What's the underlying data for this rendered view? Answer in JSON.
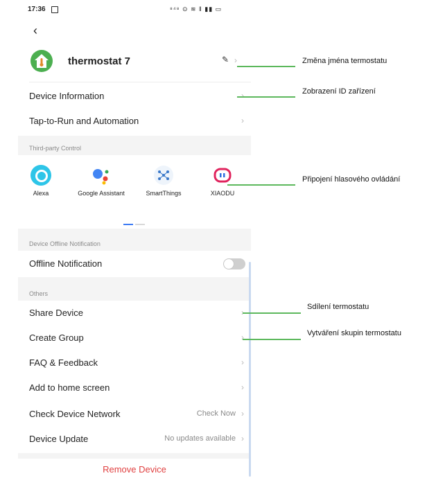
{
  "status_bar": {
    "time": "17:36",
    "icons_text": "⁸⁴⁸ ⊙ ≋ ‖ ▮▮ ▭"
  },
  "header": {
    "device_name": "thermostat 7",
    "edit_icon": "pencil-icon",
    "avatar_icon": "thermostat-house-icon"
  },
  "rows_top": [
    {
      "label": "Device Information"
    },
    {
      "label": "Tap-to-Run and Automation"
    }
  ],
  "third_party": {
    "section_title": "Third-party Control",
    "items": [
      {
        "label": "Alexa",
        "icon": "alexa-icon"
      },
      {
        "label": "Google Assistant",
        "icon": "google-assistant-icon"
      },
      {
        "label": "SmartThings",
        "icon": "smartthings-icon"
      },
      {
        "label": "XIAODU",
        "icon": "xiaodu-icon"
      }
    ]
  },
  "offline": {
    "section_title": "Device Offline Notification",
    "label": "Offline Notification",
    "enabled": false
  },
  "others": {
    "section_title": "Others",
    "rows": [
      {
        "label": "Share Device",
        "value": ""
      },
      {
        "label": "Create Group",
        "value": ""
      },
      {
        "label": "FAQ & Feedback",
        "value": ""
      },
      {
        "label": "Add to home screen",
        "value": ""
      },
      {
        "label": "Check Device Network",
        "value": "Check Now"
      },
      {
        "label": "Device Update",
        "value": "No updates available"
      }
    ]
  },
  "remove_label": "Remove Device",
  "annotations": [
    "Změna jména termostatu",
    "Zobrazení ID zařízení",
    "Připojení hlasového ovládání",
    "Sdílení termostatu",
    "Vytváření skupin termostatu"
  ],
  "colors": {
    "accent_green": "#4caf50",
    "remove_red": "#e04040",
    "pager_blue": "#3d7bf4",
    "annotation_line": "#5cb85c"
  }
}
